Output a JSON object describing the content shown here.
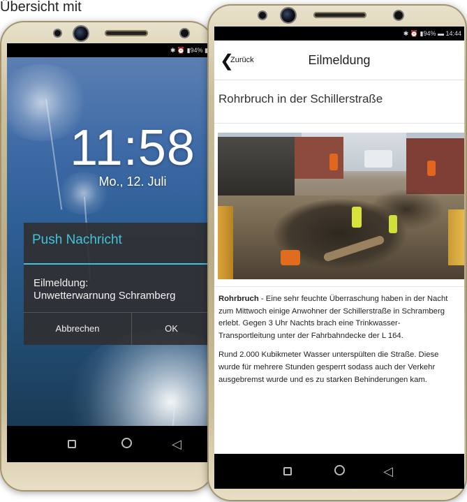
{
  "caption": "Übersicht mit",
  "left_phone": {
    "status": "✱ ⏰ ▮94% ▮",
    "clock": "11:58",
    "date": "Mo., 12. Juli",
    "dialog": {
      "title": "Push Nachricht",
      "message_line1": "Eilmeldung:",
      "message_line2": "Unwetterwarnung Schramberg",
      "cancel_label": "Abbrechen",
      "ok_label": "OK"
    }
  },
  "right_phone": {
    "status": "✱ ⏰ ▮94% ▬ 14:44",
    "back_label": "Zurück",
    "header_title": "Eilmeldung",
    "article_title": "Rohrbruch in der Schillerstraße",
    "body": {
      "lead": "Rohrbruch",
      "p1_rest": " - Eine sehr feuchte Überraschung haben in der Nacht zum Mittwoch einige Anwohner der Schillerstraße in Schramberg erlebt. Gegen 3 Uhr Nachts brach eine Trinkwasser-Transportleitung unter der Fahrbahndecke der L 164.",
      "p2": "Rund 2.000 Kubikmeter Wasser unterspülten die Straße. Diese wurde für mehrere Stunden gesperrt sodass auch der Verkehr ausgebremst wurde und es zu starken Behinderungen kam."
    }
  },
  "colors": {
    "dialog_accent": "#41c3da",
    "phone_frame": "#cbbf9c"
  },
  "icons": {
    "back": "chevron-left-icon",
    "recent": "square-icon",
    "home": "circle-icon",
    "nav_back": "triangle-back-icon"
  }
}
